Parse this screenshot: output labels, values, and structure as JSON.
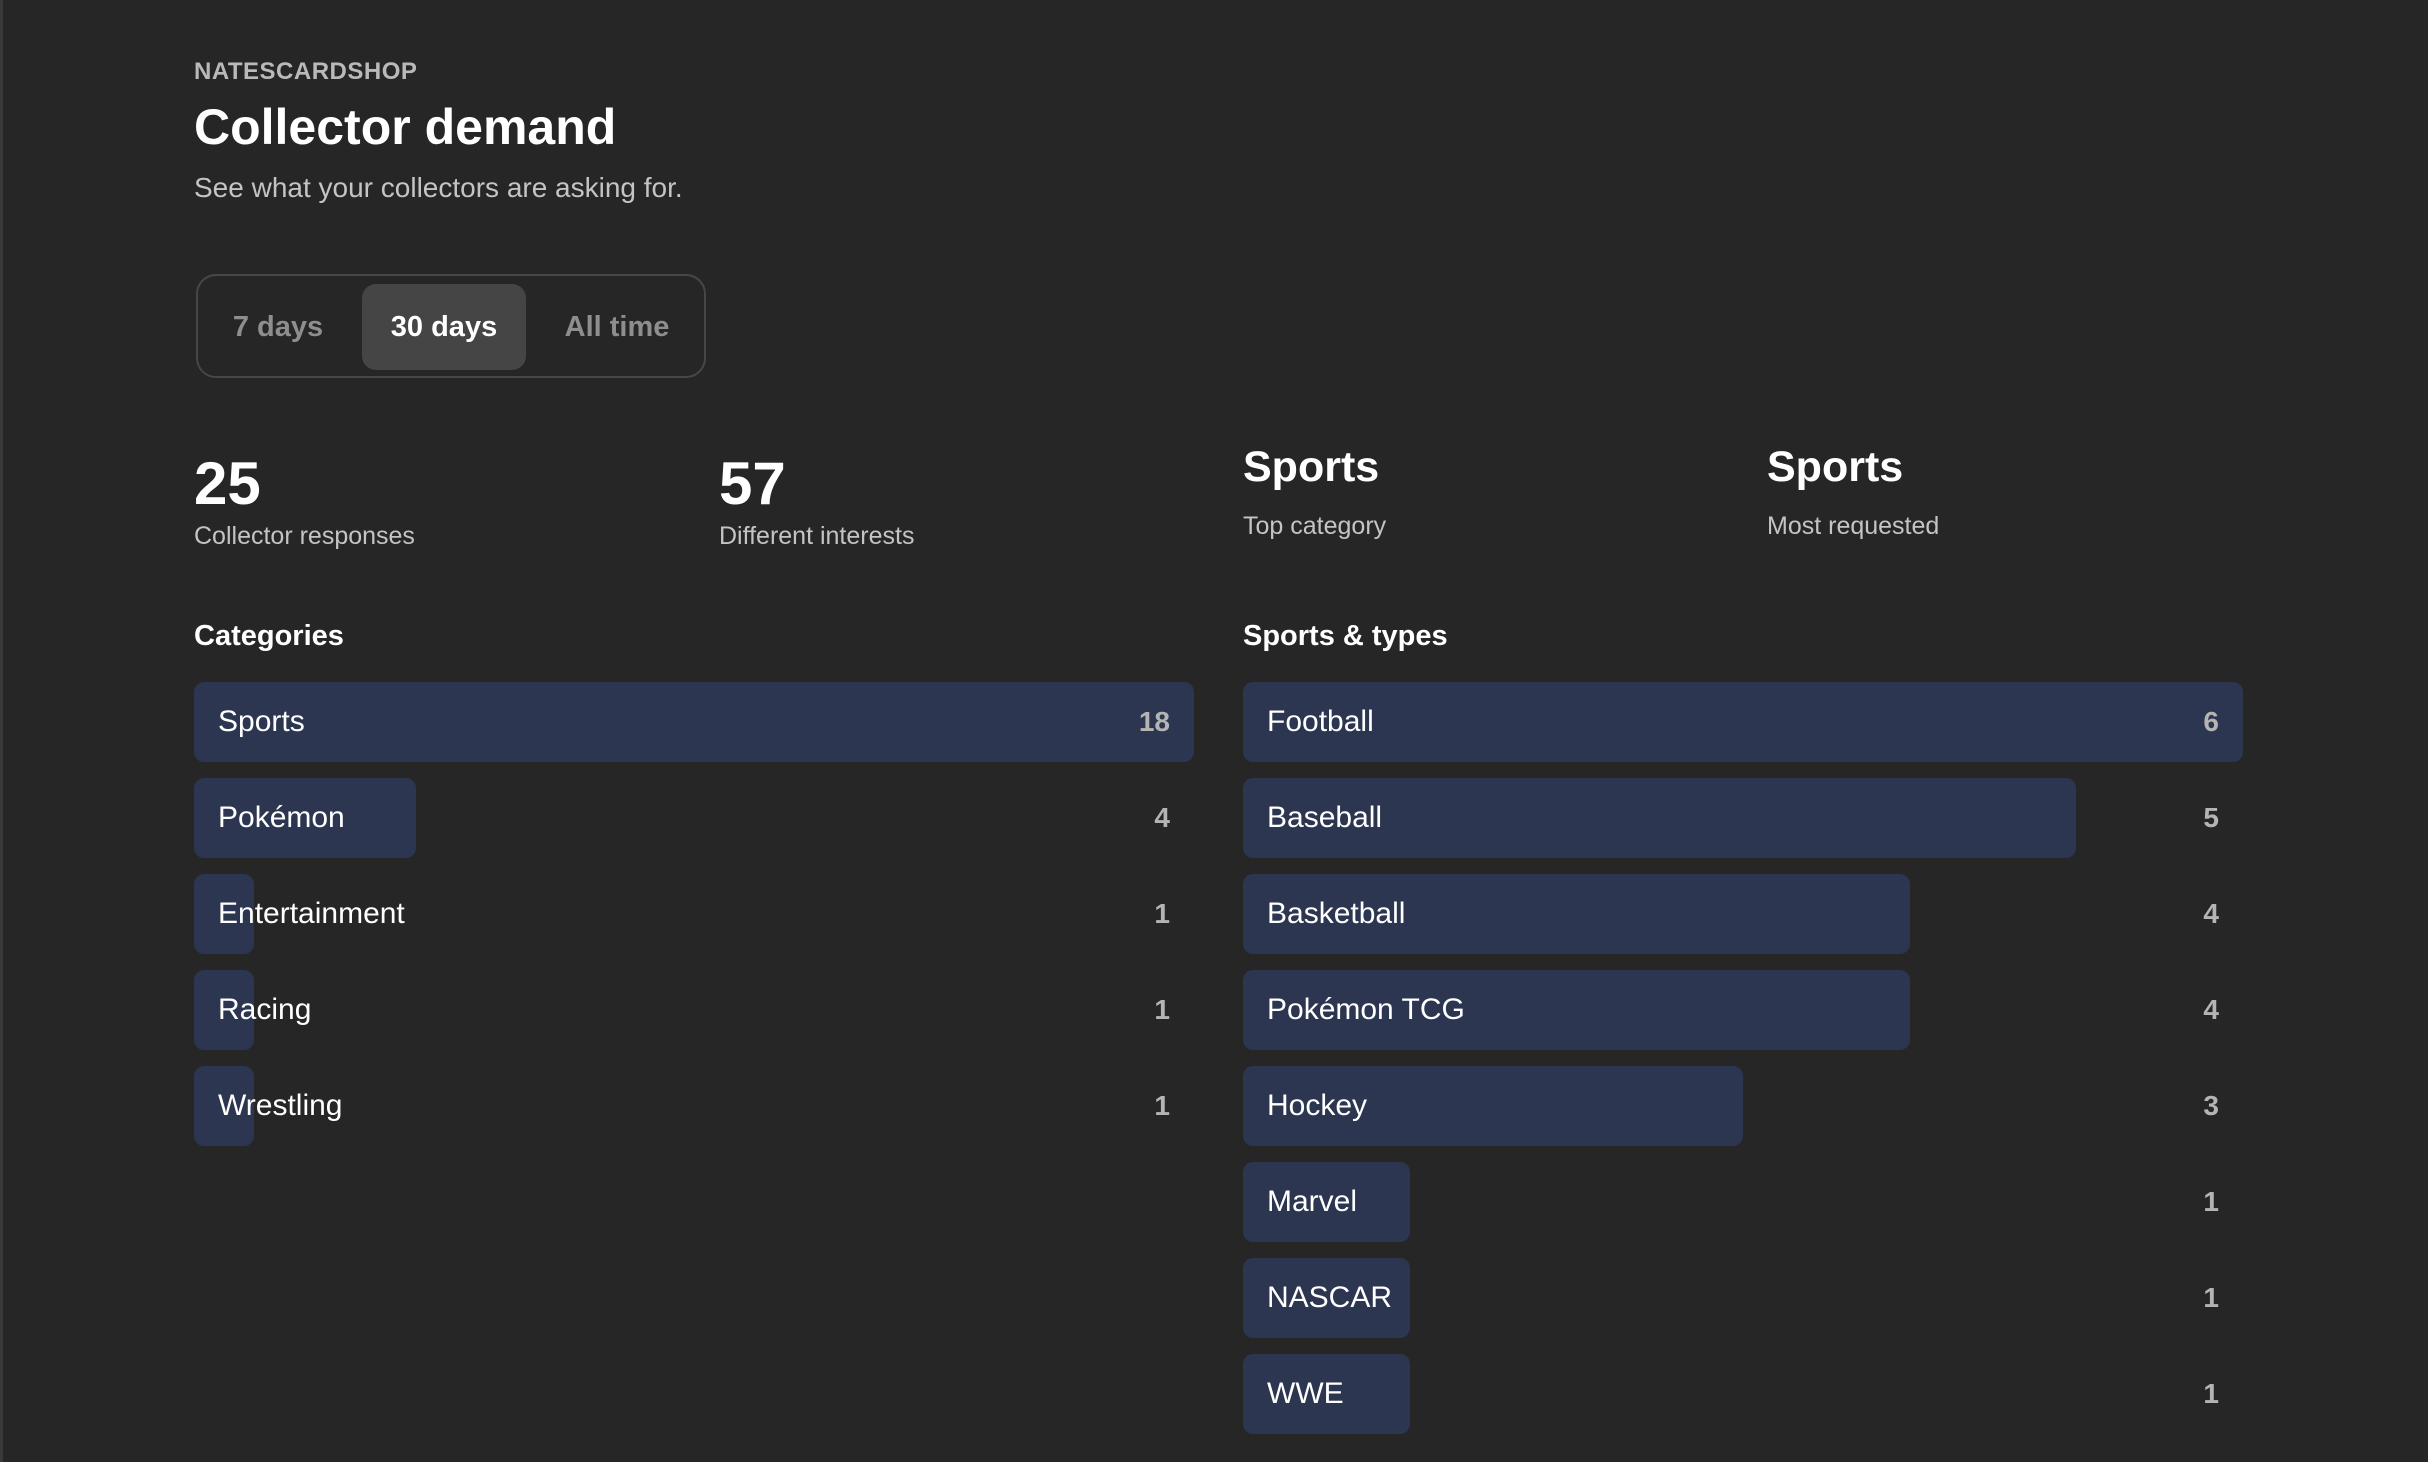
{
  "header": {
    "brand": "NATESCARDSHOP",
    "title": "Collector demand",
    "subtitle": "See what your collectors are asking for."
  },
  "range_toggle": {
    "options": [
      "7 days",
      "30 days",
      "All time"
    ],
    "selected": "30 days"
  },
  "stats": [
    {
      "value": "25",
      "label": "Collector responses"
    },
    {
      "value": "57",
      "label": "Different interests"
    },
    {
      "value": "Sports",
      "label": "Top category"
    },
    {
      "value": "Sports",
      "label": "Most requested"
    }
  ],
  "categories": {
    "title": "Categories",
    "items": [
      {
        "label": "Sports",
        "count": 18
      },
      {
        "label": "Pokémon",
        "count": 4
      },
      {
        "label": "Entertainment",
        "count": 1
      },
      {
        "label": "Racing",
        "count": 1
      },
      {
        "label": "Wrestling",
        "count": 1
      }
    ]
  },
  "sports_types": {
    "title": "Sports & types",
    "items": [
      {
        "label": "Football",
        "count": 6
      },
      {
        "label": "Baseball",
        "count": 5
      },
      {
        "label": "Basketball",
        "count": 4
      },
      {
        "label": "Pokémon TCG",
        "count": 4
      },
      {
        "label": "Hockey",
        "count": 3
      },
      {
        "label": "Marvel",
        "count": 1
      },
      {
        "label": "NASCAR",
        "count": 1
      },
      {
        "label": "WWE",
        "count": 1
      }
    ]
  },
  "colors": {
    "background": "#262626",
    "bar": "#2c3650",
    "toggle_active": "#454545"
  }
}
